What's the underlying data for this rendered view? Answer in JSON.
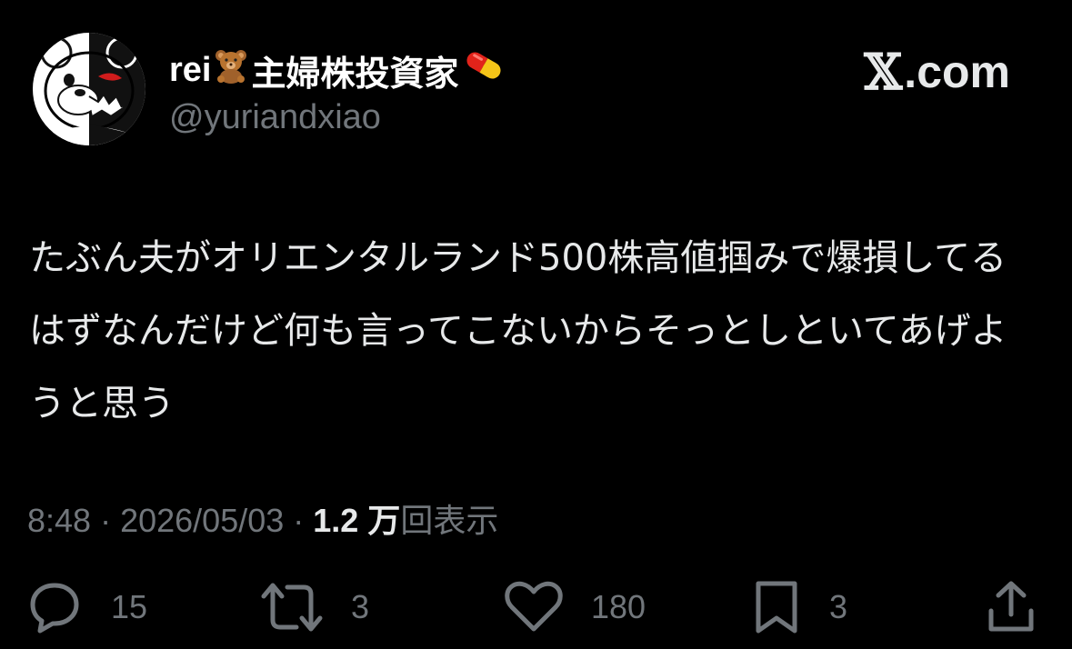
{
  "author": {
    "name": "rei",
    "name_suffix": "主婦株投資家",
    "bear_emoji": "teddy-bear-icon",
    "pill_emoji": "pill-icon",
    "handle": "@yuriandxiao"
  },
  "brand": {
    "label": ".com",
    "mark": "𝕏"
  },
  "tweet": {
    "text": "たぶん夫がオリエンタルランド500株高値掴みで爆損してるはずなんだけど何も言ってこないからそっとしといてあげようと思う"
  },
  "meta": {
    "time": "8:48",
    "separator": "·",
    "date": "2026/05/03",
    "views_count": "1.2 万",
    "views_label": "回表示"
  },
  "actions": {
    "replies": "15",
    "reposts": "3",
    "likes": "180",
    "bookmarks": "3"
  },
  "colors": {
    "background": "#000000",
    "text": "#e7e9ea",
    "muted": "#71767b"
  }
}
